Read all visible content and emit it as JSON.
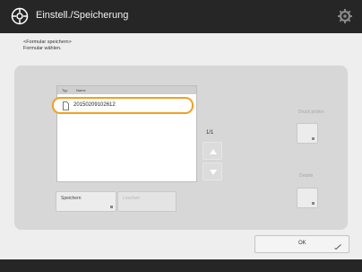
{
  "title": "Einstell./Speicherung",
  "instructions": [
    "<Formular speichern>",
    "Formular wählen."
  ],
  "list": {
    "header_type": "Typ",
    "header_name": "Name",
    "items": [
      {
        "name": "20150209102612",
        "selected": true
      }
    ]
  },
  "pager": "1/1",
  "buttons": {
    "speichern": "Speichern",
    "loeschen": "Löschen",
    "druck_label": "Druck prüfen",
    "details_label": "Details",
    "ok": "OK"
  },
  "colors": {
    "titlebar": "#262626",
    "selection_outline": "#f0a020",
    "panel": "#d7d7d7"
  },
  "icons": {
    "title": "settings-registration-icon",
    "top_right": "gear-icon",
    "file": "document-icon"
  }
}
